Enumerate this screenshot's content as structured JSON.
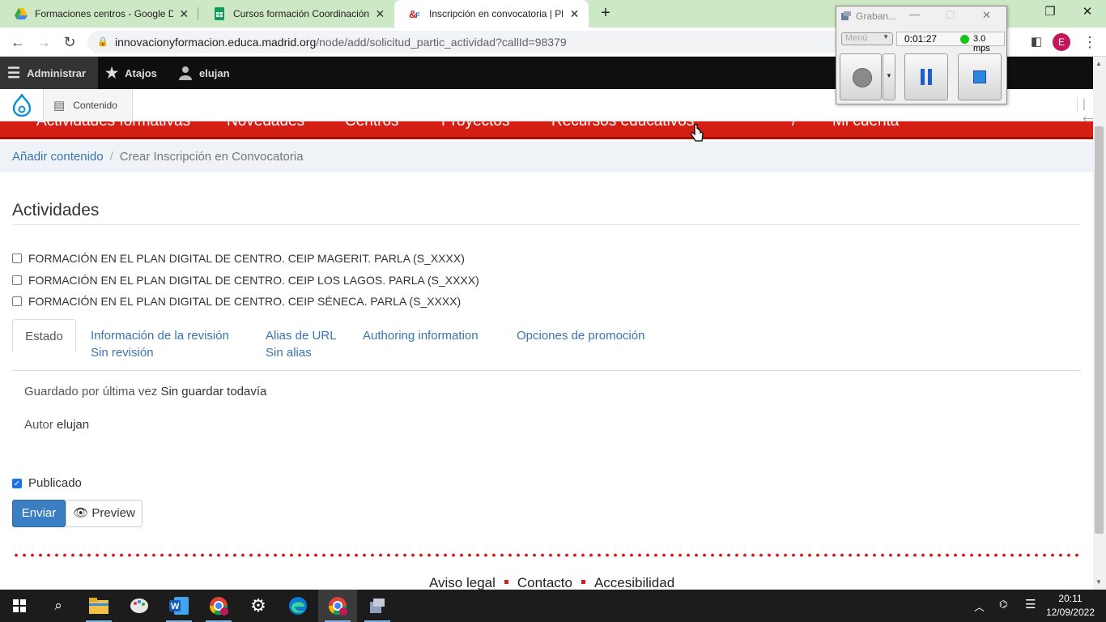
{
  "browser": {
    "tabs": [
      {
        "label": "Formaciones centros - Google Drive"
      },
      {
        "label": "Cursos formación Coordinación"
      },
      {
        "label": "Inscripción en convocatoria | Plataforma"
      }
    ],
    "url_host": "innovacionyformacion.educa.madrid.org",
    "url_path": "/node/add/solicitud_partic_actividad?callId=98379",
    "profile_initial": "E"
  },
  "toolbar": {
    "admin": "Administrar",
    "shortcuts": "Atajos",
    "user": "elujan",
    "content": "Contenido"
  },
  "rednav": {
    "items": [
      "Actividades formativas",
      "Novedades",
      "Centros",
      "Proyectos",
      "Recursos educativos",
      "Mi cuenta"
    ]
  },
  "breadcrumb": {
    "link": "Añadir contenido",
    "current": "Crear Inscripción en Convocatoria"
  },
  "form": {
    "section_title": "Actividades",
    "activities": [
      "FORMACIÓN EN EL PLAN DIGITAL DE CENTRO. CEIP MAGERIT. PARLA (S_XXXX)",
      "FORMACIÓN EN EL PLAN DIGITAL DE CENTRO. CEIP LOS LAGOS. PARLA (S_XXXX)",
      "FORMACIÓN EN EL PLAN DIGITAL DE CENTRO. CEIP SÉNECA. PARLA (S_XXXX)"
    ],
    "tabs": [
      {
        "label": "Estado",
        "sub": ""
      },
      {
        "label": "Información de la revisión",
        "sub": "Sin revisión"
      },
      {
        "label": "Alias de URL",
        "sub": "Sin alias"
      },
      {
        "label": "Authoring information",
        "sub": ""
      },
      {
        "label": "Opciones de promoción",
        "sub": ""
      }
    ],
    "saved_label": "Guardado por última vez",
    "saved_value": "Sin guardar todavía",
    "author_label": "Autor",
    "author_value": "elujan",
    "published_label": "Publicado",
    "published": true,
    "submit": "Enviar",
    "preview": "Preview"
  },
  "footer": {
    "links": [
      "Aviso legal",
      "Contacto",
      "Accesibilidad"
    ]
  },
  "recorder": {
    "title": "Graban...",
    "menu": "Menú",
    "time": "0:01:27",
    "rate": "3.0 mps"
  },
  "taskbar": {
    "time": "20:11",
    "date": "12/09/2022"
  },
  "colors": {
    "brand_red": "#d51e14",
    "link_blue": "#3a73b0",
    "tab_bar_green": "#cde8c4"
  }
}
